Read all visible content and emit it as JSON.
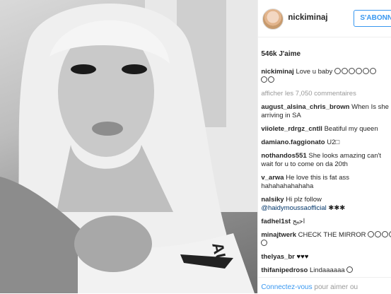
{
  "header": {
    "username": "nickiminaj",
    "follow_label": "S'ABONNER"
  },
  "likes": "546k J'aime",
  "caption": {
    "user": "nickiminaj",
    "text": "Love u baby"
  },
  "view_all": "afficher les 7,050 commentaires",
  "comments": [
    {
      "user": "august_alsina_chris_brown",
      "text": "When Is she",
      "cont": "arriving in SA"
    },
    {
      "user": "viiolete_rdrgz_cntll",
      "text": "Beatiful my queen"
    },
    {
      "user": "damiano.faggionato",
      "text": "U2"
    },
    {
      "user": "nothandos551",
      "text": "She looks amazing can't",
      "cont": "wait for u to come on da 20th"
    },
    {
      "user": "v_arwa",
      "text": "He love this is fat ass",
      "cont": "hahahahahahaha"
    },
    {
      "user": "nalsiky",
      "text": "Hi plz follow",
      "mention": "@haidymoussaofficial"
    },
    {
      "user": "fadhel1st",
      "text": "احبج"
    },
    {
      "user": "minajtwerk",
      "text": "CHECK THE MIRROR"
    },
    {
      "user": "thelyas_br",
      "text": "♥♥♥"
    },
    {
      "user": "thifanipedroso",
      "text": "Lindaaaaaa"
    }
  ],
  "footer": {
    "link": "Connectez-vous",
    "text": "pour aimer ou"
  },
  "photo_text": "AU"
}
